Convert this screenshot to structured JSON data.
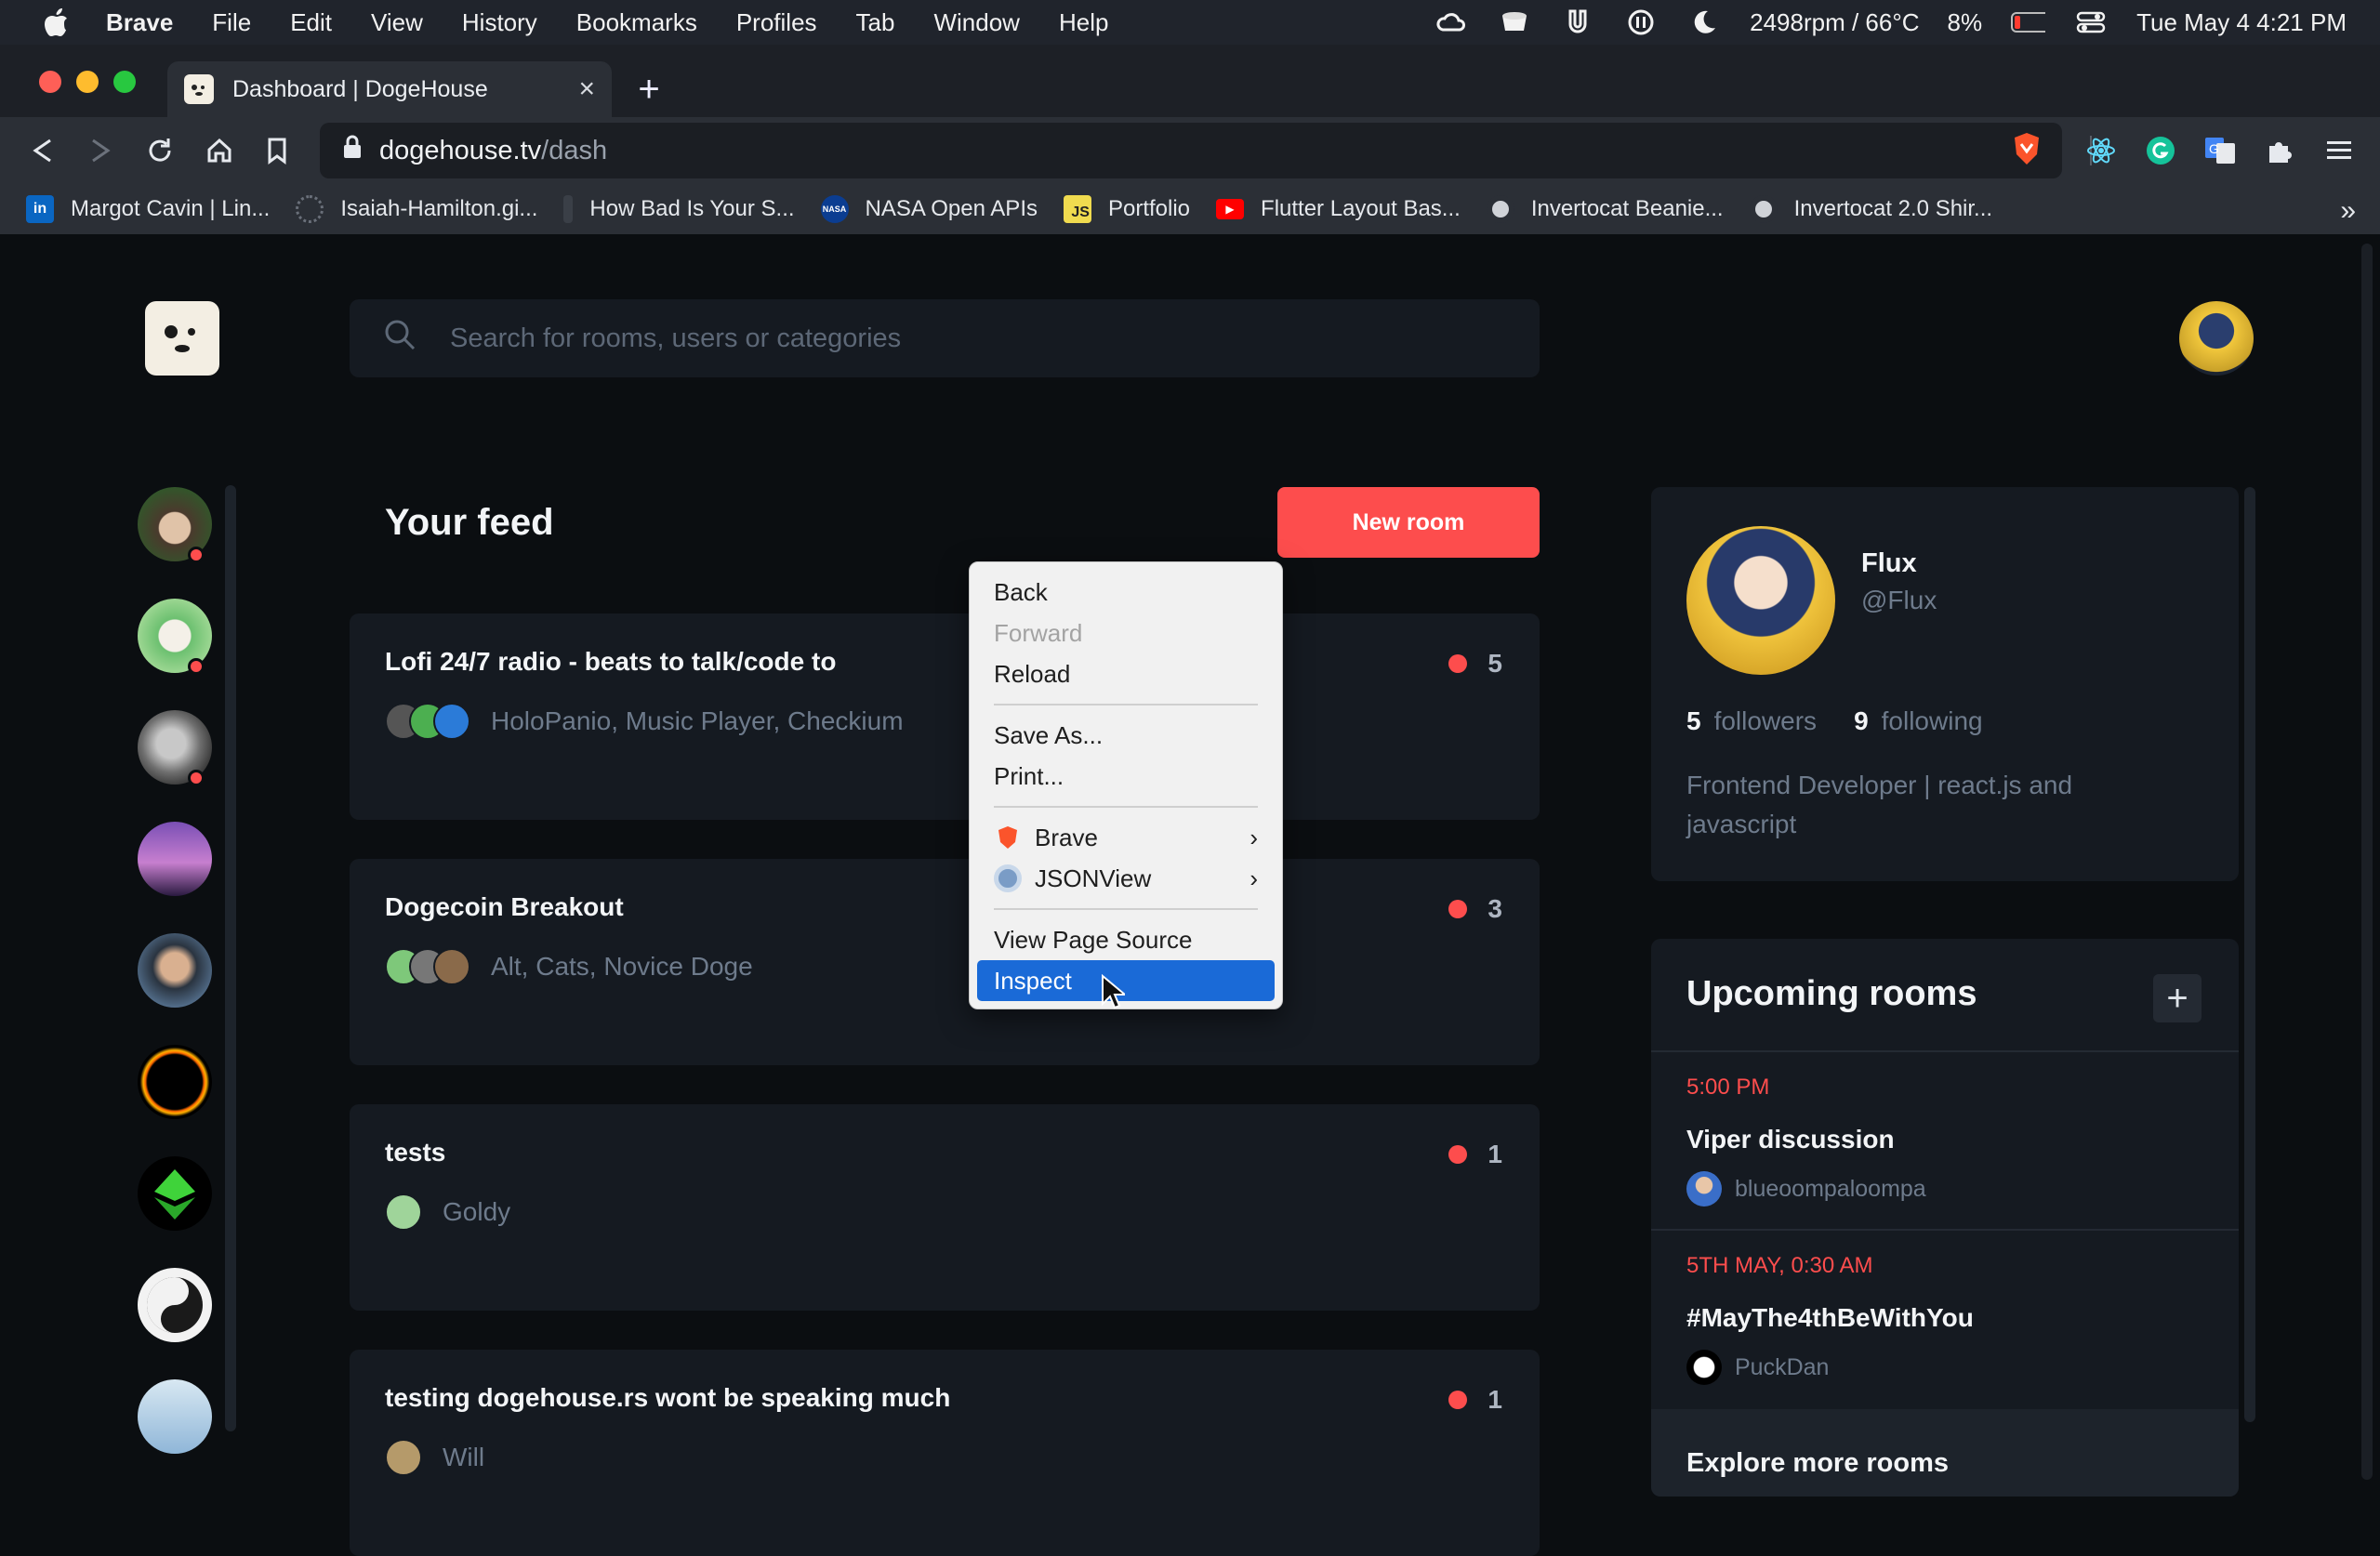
{
  "macos": {
    "menu_items": [
      "Brave",
      "File",
      "Edit",
      "View",
      "History",
      "Bookmarks",
      "Profiles",
      "Tab",
      "Window",
      "Help"
    ],
    "status_text": "2498rpm / 66°C",
    "battery": "8%",
    "clock": "Tue May 4  4:21 PM"
  },
  "browser": {
    "tab_title": "Dashboard | DogeHouse",
    "url_host": "dogehouse.tv",
    "url_path": "/dash",
    "bookmarks": [
      {
        "label": "Margot Cavin | Lin...",
        "icon": "linkedin-icon",
        "color": "#0a66c2"
      },
      {
        "label": "Isaiah-Hamilton.gi...",
        "icon": "spinner-icon",
        "color": "#555a63"
      },
      {
        "label": "How Bad Is Your S...",
        "icon": "doc-icon",
        "color": "#3a3f47"
      },
      {
        "label": "NASA Open APIs",
        "icon": "nasa-icon",
        "color": "#0b3d91"
      },
      {
        "label": "Portfolio",
        "icon": "js-icon",
        "color": "#f0db4f"
      },
      {
        "label": "Flutter Layout Bas...",
        "icon": "youtube-icon",
        "color": "#ff0000"
      },
      {
        "label": "Invertocat Beanie...",
        "icon": "github-icon",
        "color": "#24292e"
      },
      {
        "label": "Invertocat 2.0 Shir...",
        "icon": "github-icon",
        "color": "#24292e"
      }
    ]
  },
  "search": {
    "placeholder": "Search for rooms, users or categories"
  },
  "feed": {
    "title": "Your feed",
    "new_room_label": "New room",
    "rooms": [
      {
        "title": "Lofi 24/7 radio - beats to talk/code to",
        "count": "5",
        "people": "HoloPanio, Music Player, Checkium"
      },
      {
        "title": "Dogecoin Breakout",
        "count": "3",
        "people": "Alt, Cats, Novice Doge"
      },
      {
        "title": "tests",
        "count": "1",
        "people": "Goldy"
      },
      {
        "title": "testing dogehouse.rs wont be speaking much",
        "count": "1",
        "people": "Will"
      }
    ]
  },
  "context_menu": {
    "back": "Back",
    "forward": "Forward",
    "reload": "Reload",
    "save_as": "Save As...",
    "print": "Print...",
    "brave": "Brave",
    "jsonview": "JSONView",
    "view_source": "View Page Source",
    "inspect": "Inspect"
  },
  "profile": {
    "name": "Flux",
    "handle": "@Flux",
    "followers_count": "5",
    "followers_label": "followers",
    "following_count": "9",
    "following_label": "following",
    "bio": "Frontend Developer | react.js and javascript"
  },
  "upcoming": {
    "title": "Upcoming rooms",
    "rooms": [
      {
        "time": "5:00 PM",
        "name": "Viper discussion",
        "user": "blueoompaloompa"
      },
      {
        "time": "5TH MAY, 0:30 AM",
        "name": "#MayThe4thBeWithYou",
        "user": "PuckDan"
      }
    ],
    "explore_label": "Explore more rooms"
  },
  "colors": {
    "accent": "#fd4d4d",
    "page_bg": "#0b0e11",
    "card_bg": "#151a21",
    "selection": "#1a6ad7"
  }
}
